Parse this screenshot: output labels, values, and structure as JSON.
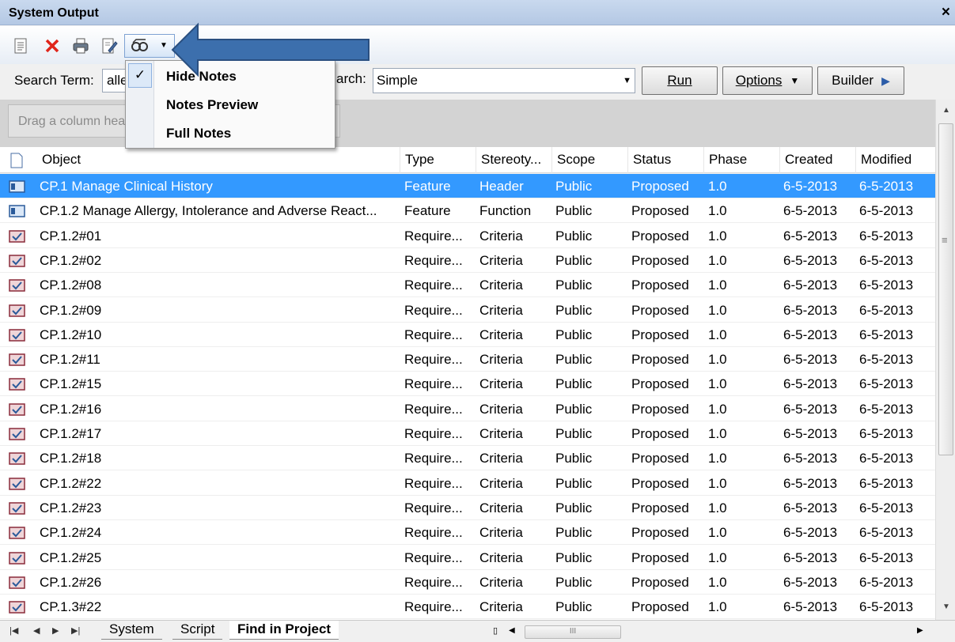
{
  "window": {
    "title": "System Output",
    "close_label": "×"
  },
  "toolbar": {
    "buttons": [
      "new-document-icon",
      "delete-icon",
      "print-icon",
      "edit-icon",
      "notes-filter-icon"
    ]
  },
  "search": {
    "term_label": "Search Term:",
    "term_value": "allergy",
    "type_label": "arch:",
    "type_value": "Simple",
    "run_label": "Run",
    "options_label": "Options",
    "builder_label": "Builder"
  },
  "group": {
    "hint": "Drag a column header here to group by that column"
  },
  "notes_menu": {
    "items": [
      {
        "label": "Hide Notes",
        "checked": true
      },
      {
        "label": "Notes Preview",
        "checked": false
      },
      {
        "label": "Full Notes",
        "checked": false
      }
    ]
  },
  "grid": {
    "columns": [
      "Object",
      "Type",
      "Stereoty...",
      "Scope",
      "Status",
      "Phase",
      "Created",
      "Modified"
    ],
    "rows": [
      {
        "icon": "feature-icon",
        "object": "CP.1 Manage Clinical History",
        "type": "Feature",
        "stereotype": "Header",
        "scope": "Public",
        "status": "Proposed",
        "phase": "1.0",
        "created": "6-5-2013",
        "modified": "6-5-2013",
        "selected": true
      },
      {
        "icon": "feature-icon",
        "object": "CP.1.2 Manage Allergy, Intolerance and Adverse React...",
        "type": "Feature",
        "stereotype": "Function",
        "scope": "Public",
        "status": "Proposed",
        "phase": "1.0",
        "created": "6-5-2013",
        "modified": "6-5-2013"
      },
      {
        "icon": "requirement-icon",
        "object": "CP.1.2#01",
        "type": "Require...",
        "stereotype": "Criteria",
        "scope": "Public",
        "status": "Proposed",
        "phase": "1.0",
        "created": "6-5-2013",
        "modified": "6-5-2013"
      },
      {
        "icon": "requirement-icon",
        "object": "CP.1.2#02",
        "type": "Require...",
        "stereotype": "Criteria",
        "scope": "Public",
        "status": "Proposed",
        "phase": "1.0",
        "created": "6-5-2013",
        "modified": "6-5-2013"
      },
      {
        "icon": "requirement-icon",
        "object": "CP.1.2#08",
        "type": "Require...",
        "stereotype": "Criteria",
        "scope": "Public",
        "status": "Proposed",
        "phase": "1.0",
        "created": "6-5-2013",
        "modified": "6-5-2013"
      },
      {
        "icon": "requirement-icon",
        "object": "CP.1.2#09",
        "type": "Require...",
        "stereotype": "Criteria",
        "scope": "Public",
        "status": "Proposed",
        "phase": "1.0",
        "created": "6-5-2013",
        "modified": "6-5-2013"
      },
      {
        "icon": "requirement-icon",
        "object": "CP.1.2#10",
        "type": "Require...",
        "stereotype": "Criteria",
        "scope": "Public",
        "status": "Proposed",
        "phase": "1.0",
        "created": "6-5-2013",
        "modified": "6-5-2013"
      },
      {
        "icon": "requirement-icon",
        "object": "CP.1.2#11",
        "type": "Require...",
        "stereotype": "Criteria",
        "scope": "Public",
        "status": "Proposed",
        "phase": "1.0",
        "created": "6-5-2013",
        "modified": "6-5-2013"
      },
      {
        "icon": "requirement-icon",
        "object": "CP.1.2#15",
        "type": "Require...",
        "stereotype": "Criteria",
        "scope": "Public",
        "status": "Proposed",
        "phase": "1.0",
        "created": "6-5-2013",
        "modified": "6-5-2013"
      },
      {
        "icon": "requirement-icon",
        "object": "CP.1.2#16",
        "type": "Require...",
        "stereotype": "Criteria",
        "scope": "Public",
        "status": "Proposed",
        "phase": "1.0",
        "created": "6-5-2013",
        "modified": "6-5-2013"
      },
      {
        "icon": "requirement-icon",
        "object": "CP.1.2#17",
        "type": "Require...",
        "stereotype": "Criteria",
        "scope": "Public",
        "status": "Proposed",
        "phase": "1.0",
        "created": "6-5-2013",
        "modified": "6-5-2013"
      },
      {
        "icon": "requirement-icon",
        "object": "CP.1.2#18",
        "type": "Require...",
        "stereotype": "Criteria",
        "scope": "Public",
        "status": "Proposed",
        "phase": "1.0",
        "created": "6-5-2013",
        "modified": "6-5-2013"
      },
      {
        "icon": "requirement-icon",
        "object": "CP.1.2#22",
        "type": "Require...",
        "stereotype": "Criteria",
        "scope": "Public",
        "status": "Proposed",
        "phase": "1.0",
        "created": "6-5-2013",
        "modified": "6-5-2013"
      },
      {
        "icon": "requirement-icon",
        "object": "CP.1.2#23",
        "type": "Require...",
        "stereotype": "Criteria",
        "scope": "Public",
        "status": "Proposed",
        "phase": "1.0",
        "created": "6-5-2013",
        "modified": "6-5-2013"
      },
      {
        "icon": "requirement-icon",
        "object": "CP.1.2#24",
        "type": "Require...",
        "stereotype": "Criteria",
        "scope": "Public",
        "status": "Proposed",
        "phase": "1.0",
        "created": "6-5-2013",
        "modified": "6-5-2013"
      },
      {
        "icon": "requirement-icon",
        "object": "CP.1.2#25",
        "type": "Require...",
        "stereotype": "Criteria",
        "scope": "Public",
        "status": "Proposed",
        "phase": "1.0",
        "created": "6-5-2013",
        "modified": "6-5-2013"
      },
      {
        "icon": "requirement-icon",
        "object": "CP.1.2#26",
        "type": "Require...",
        "stereotype": "Criteria",
        "scope": "Public",
        "status": "Proposed",
        "phase": "1.0",
        "created": "6-5-2013",
        "modified": "6-5-2013"
      },
      {
        "icon": "requirement-icon",
        "object": "CP.1.3#22",
        "type": "Require...",
        "stereotype": "Criteria",
        "scope": "Public",
        "status": "Proposed",
        "phase": "1.0",
        "created": "6-5-2013",
        "modified": "6-5-2013"
      }
    ]
  },
  "tabs": [
    {
      "label": "System",
      "active": false
    },
    {
      "label": "Script",
      "active": false
    },
    {
      "label": "Find in Project",
      "active": true
    }
  ],
  "colors": {
    "selection": "#3399ff",
    "titlebar": "#c9d9ee",
    "callout_arrow": "#3c6fad"
  }
}
